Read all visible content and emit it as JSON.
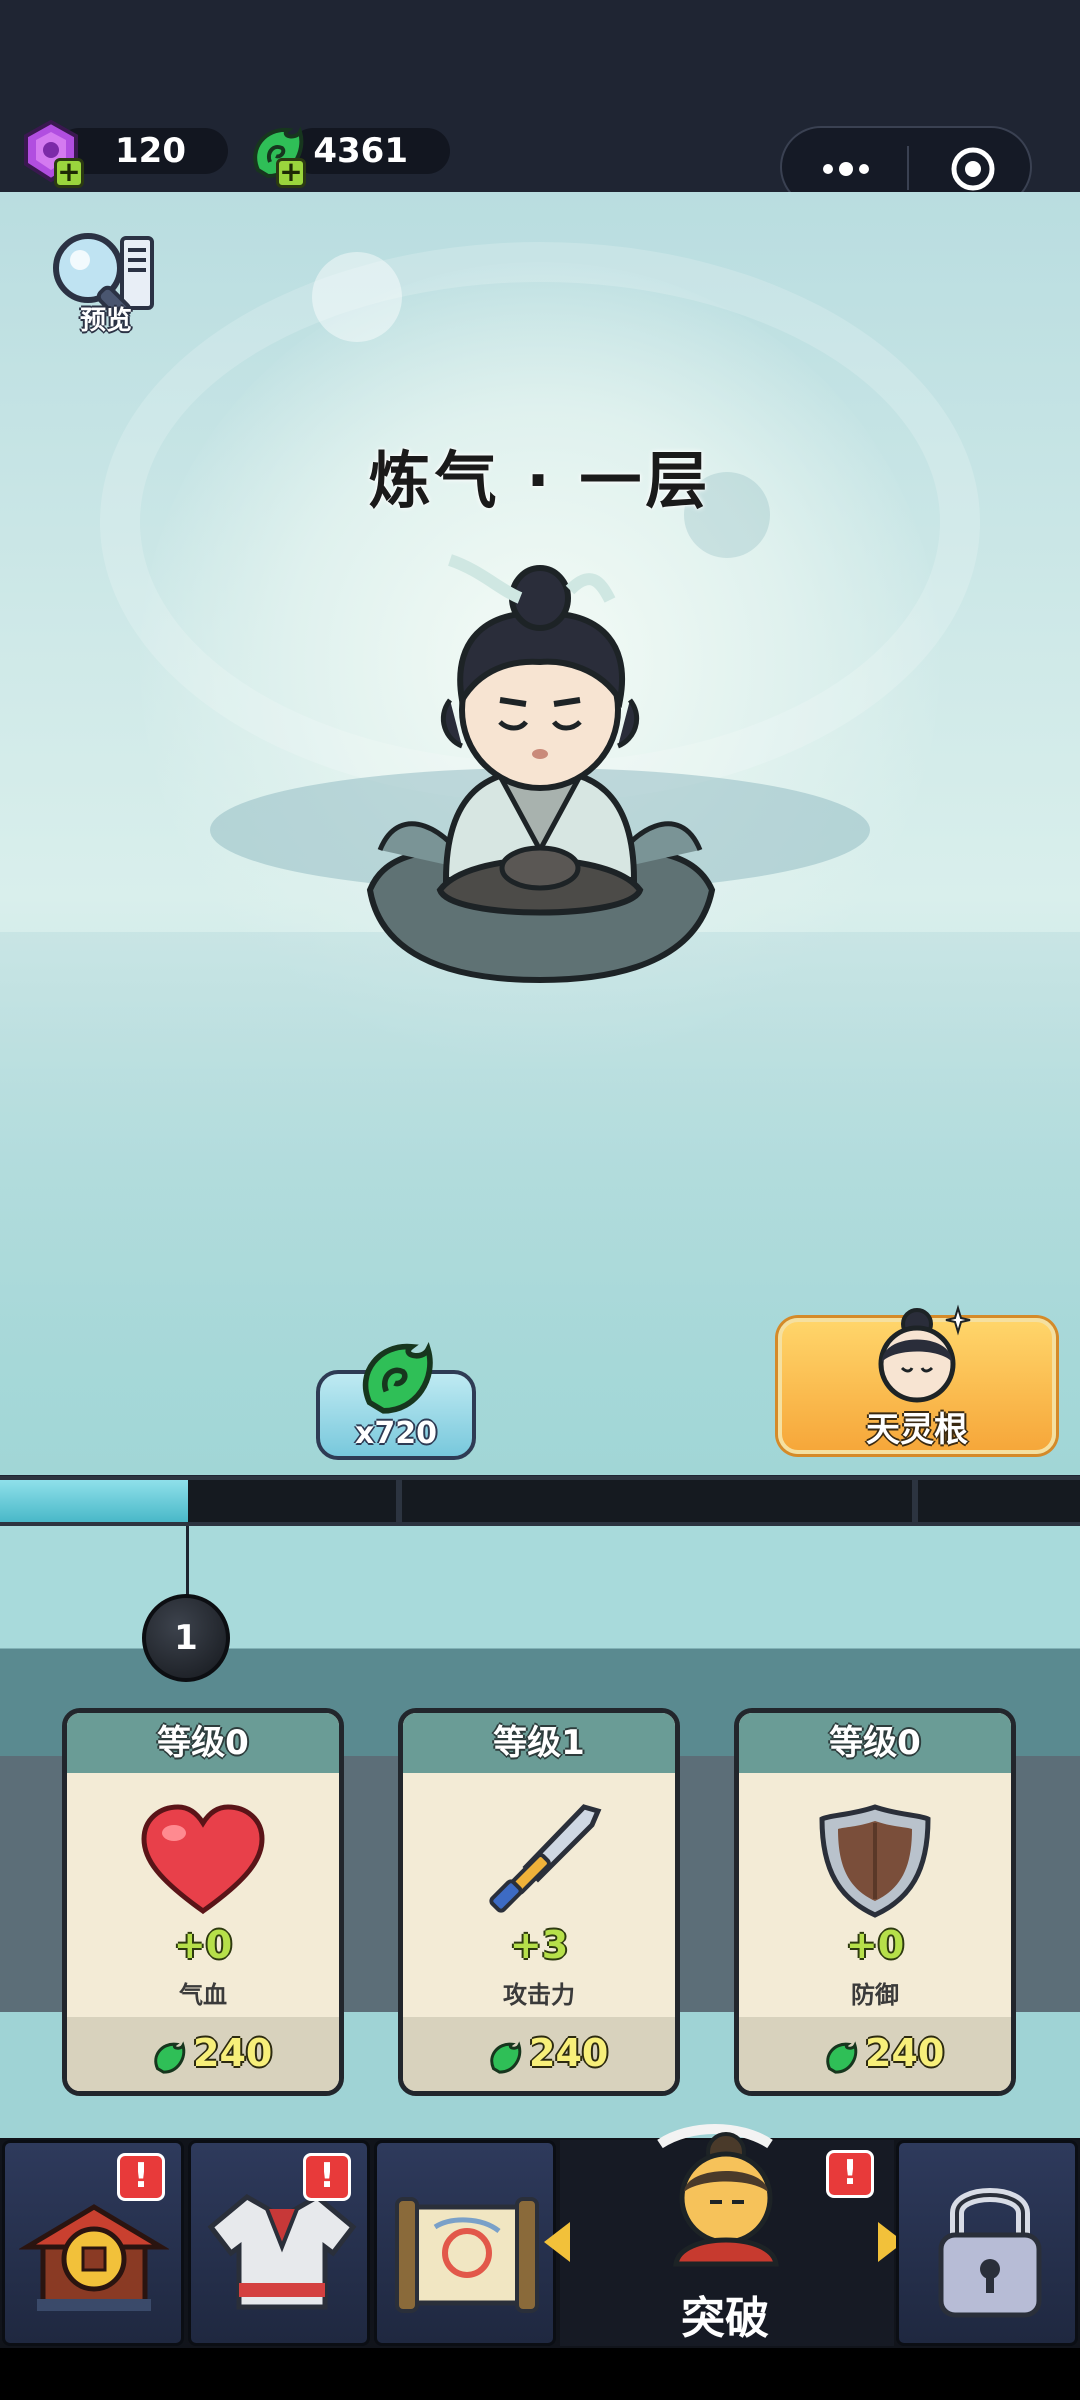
{
  "currencies": {
    "gem": {
      "icon": "purple-gem-icon",
      "value": "120"
    },
    "jade": {
      "icon": "green-jade-icon",
      "value": "4361"
    }
  },
  "preview": {
    "label": "预览",
    "icon": "magnifier-scroll-icon"
  },
  "realm_title": "炼气 · 一层",
  "rewards": {
    "jade": {
      "icon": "green-jade-icon",
      "count": "x720"
    },
    "root": {
      "label": "天灵根",
      "icon": "character-portrait-icon"
    }
  },
  "progress": {
    "fraction": 0.174,
    "ticks": [
      "10",
      "20"
    ],
    "current_level": "1"
  },
  "cards": [
    {
      "level": "等级0",
      "icon": "heart-icon",
      "bonus": "+0",
      "stat": "气血",
      "cost": "240"
    },
    {
      "level": "等级1",
      "icon": "sword-icon",
      "bonus": "+3",
      "stat": "攻击力",
      "cost": "240"
    },
    {
      "level": "等级0",
      "icon": "shield-icon",
      "bonus": "+0",
      "stat": "防御",
      "cost": "240"
    }
  ],
  "nav": {
    "items": [
      {
        "name": "shop",
        "icon": "pagoda-coin-icon",
        "badge": "!"
      },
      {
        "name": "equipment",
        "icon": "robe-icon",
        "badge": "!"
      },
      {
        "name": "scroll",
        "icon": "scroll-icon",
        "badge": ""
      }
    ],
    "center": {
      "label": "突破",
      "icon": "cultivator-icon",
      "badge": "!"
    },
    "locked": {
      "icon": "lock-icon"
    }
  },
  "colors": {
    "accent_teal": "#49b8c8",
    "jade_green": "#2fbf57",
    "gem_purple": "#b14ee0",
    "badge_red": "#e83a3a"
  }
}
